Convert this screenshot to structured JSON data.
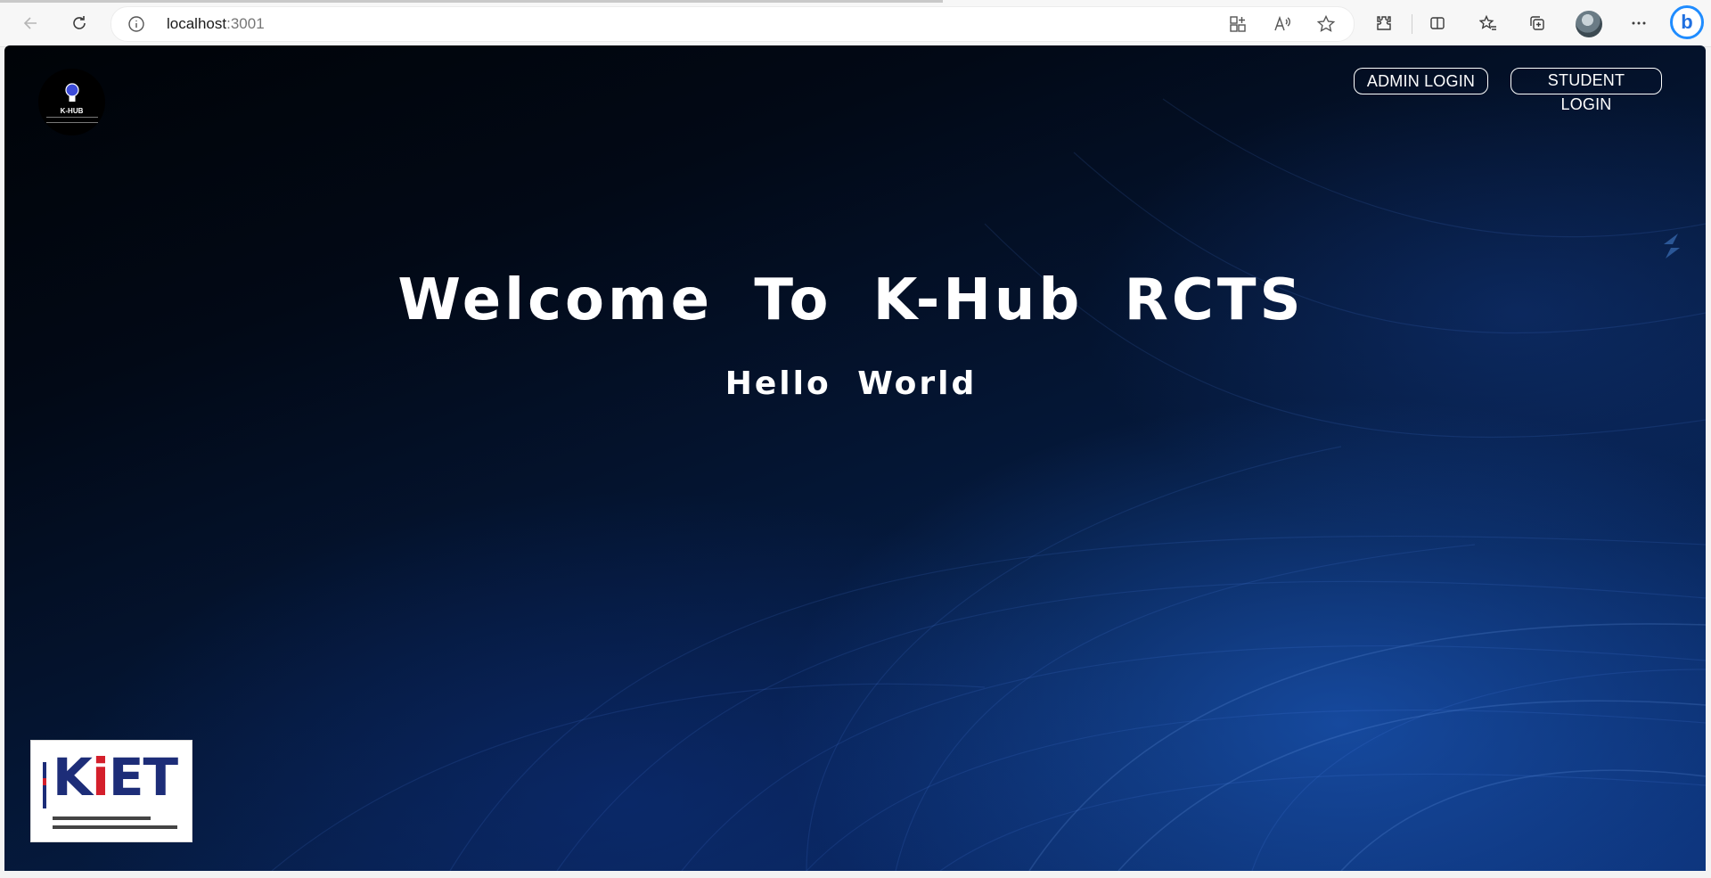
{
  "browser": {
    "url_host": "localhost",
    "url_port": ":3001",
    "icons": [
      "back-arrow-icon",
      "reload-icon",
      "site-info-icon",
      "app-available-icon",
      "read-aloud-icon",
      "favorite-star-icon",
      "extensions-icon",
      "split-screen-icon",
      "favorites-icon",
      "collections-icon",
      "profile-avatar",
      "more-options-icon",
      "copilot-icon"
    ]
  },
  "page": {
    "title": "Welcome To K-Hub RCTS",
    "subtitle": "Hello World",
    "nav": {
      "admin_label": "ADMIN LOGIN",
      "student_label": "STUDENT LOGIN"
    },
    "logo_text": "K-HUB",
    "kiet": {
      "letters_blue_1": "K",
      "letters_red": "i",
      "letters_blue_2": "ET"
    }
  },
  "colors": {
    "background_dark": "#020916",
    "background_blue": "#0b2f73",
    "text": "#ffffff",
    "kiet_blue": "#1d2d78",
    "kiet_red": "#d41f2b"
  }
}
